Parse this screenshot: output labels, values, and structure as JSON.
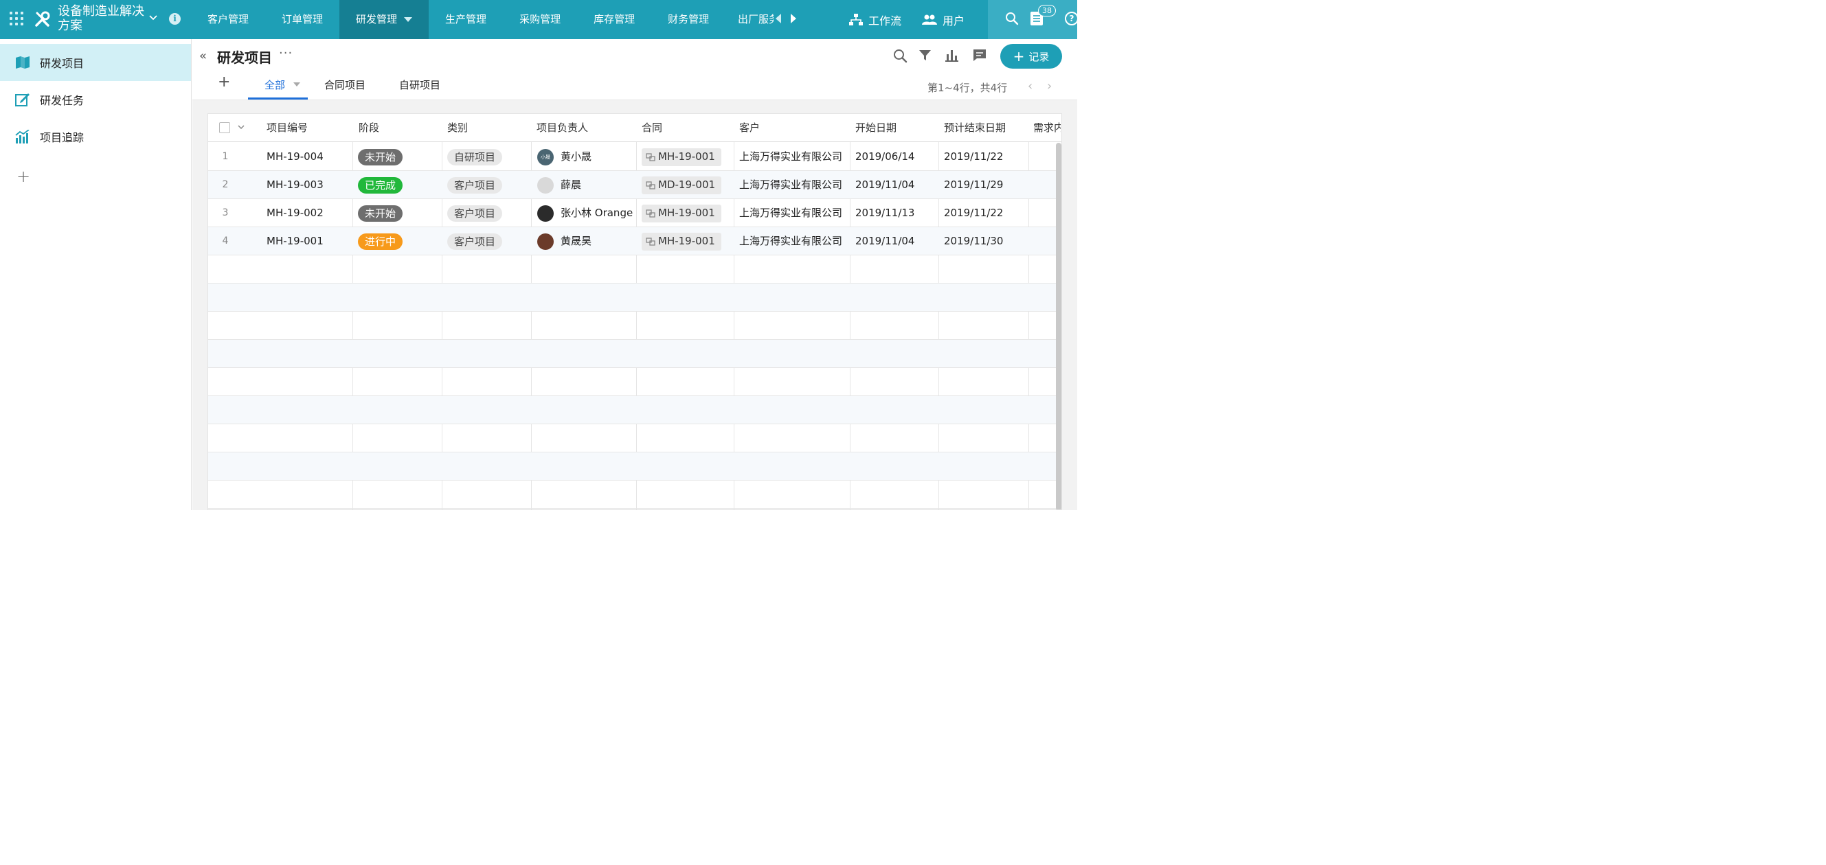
{
  "app": {
    "title": "设备制造业解决方案",
    "nav": [
      {
        "label": "客户管理",
        "active": false
      },
      {
        "label": "订单管理",
        "active": false
      },
      {
        "label": "研发管理",
        "active": true
      },
      {
        "label": "生产管理",
        "active": false
      },
      {
        "label": "采购管理",
        "active": false
      },
      {
        "label": "库存管理",
        "active": false
      },
      {
        "label": "财务管理",
        "active": false
      }
    ],
    "nav_overflow": "出厂服务",
    "workflow_label": "工作流",
    "users_label": "用户",
    "notification_count": "38"
  },
  "sidebar": {
    "items": [
      {
        "label": "研发项目",
        "icon": "book-icon",
        "active": true
      },
      {
        "label": "研发任务",
        "icon": "edit-icon",
        "active": false
      },
      {
        "label": "项目追踪",
        "icon": "chart-icon",
        "active": false
      }
    ],
    "add_label": "+"
  },
  "view": {
    "title": "研发项目",
    "more_label": "···",
    "add_record_label": "记录",
    "tabs": [
      {
        "label": "全部",
        "active": true
      },
      {
        "label": "合同项目",
        "active": false
      },
      {
        "label": "自研项目",
        "active": false
      }
    ],
    "row_count": "第1~4行，共4行"
  },
  "table": {
    "columns": [
      "项目编号",
      "阶段",
      "类别",
      "项目负责人",
      "合同",
      "客户",
      "开始日期",
      "预计结束日期",
      "需求内"
    ],
    "rows": [
      {
        "num": "1",
        "code": "MH-19-004",
        "stage": "未开始",
        "stage_color": "#6e6e6e",
        "category": "自研项目",
        "owner": "黄小晟",
        "avatar_text": "小晟",
        "avatar_color": "#4a6572",
        "contract": "MH-19-001",
        "customer": "上海万得实业有限公司",
        "start": "2019/06/14",
        "end": "2019/11/22"
      },
      {
        "num": "2",
        "code": "MH-19-003",
        "stage": "已完成",
        "stage_color": "#21b83b",
        "category": "客户项目",
        "owner": "薛晨",
        "avatar_text": "",
        "avatar_color": "#d9d9d9",
        "contract": "MD-19-001",
        "customer": "上海万得实业有限公司",
        "start": "2019/11/04",
        "end": "2019/11/29"
      },
      {
        "num": "3",
        "code": "MH-19-002",
        "stage": "未开始",
        "stage_color": "#6e6e6e",
        "category": "客户项目",
        "owner": "张小林 Orange",
        "avatar_text": "",
        "avatar_color": "#2b2b2b",
        "contract": "MH-19-001",
        "customer": "上海万得实业有限公司",
        "start": "2019/11/13",
        "end": "2019/11/22"
      },
      {
        "num": "4",
        "code": "MH-19-001",
        "stage": "进行中",
        "stage_color": "#f79a1b",
        "category": "客户项目",
        "owner": "黄晟昊",
        "avatar_text": "",
        "avatar_color": "#6b3b2a",
        "contract": "MH-19-001",
        "customer": "上海万得实业有限公司",
        "start": "2019/11/04",
        "end": "2019/11/30"
      }
    ]
  },
  "colors": {
    "accent": "#1e9fb6",
    "nav_active": "#157f93",
    "tab_active": "#1e6fd9"
  }
}
